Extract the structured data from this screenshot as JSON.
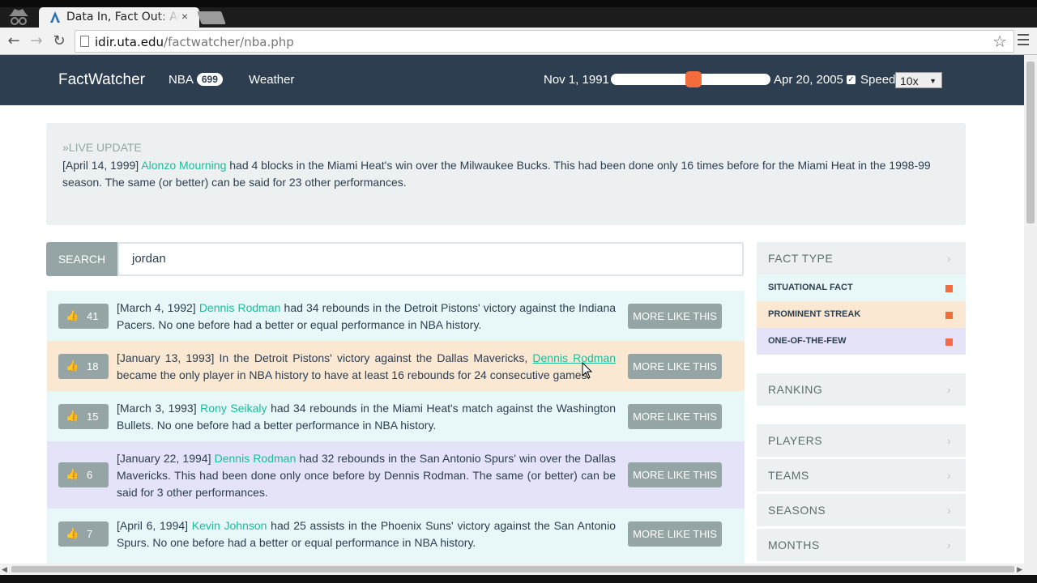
{
  "browser": {
    "tab_title": "Data In, Fact Out: Au",
    "tab_close": "×",
    "url_host": "idir.uta.edu",
    "url_path": "/factwatcher/nba.php"
  },
  "navbar": {
    "brand": "FactWatcher",
    "nba_label": "NBA",
    "nba_count": "699",
    "weather_label": "Weather",
    "date_start": "Nov 1, 1991",
    "date_end": "Apr 20, 2005",
    "date_current": "Apr 17, 1999",
    "slider_position": 0.52,
    "speed_label": "Speed",
    "speed_value": "10x",
    "speed_checked": true
  },
  "live_update": {
    "heading": "»LIVE UPDATE",
    "date": "[April 14, 1999]",
    "player": "Alonzo Mourning",
    "text": "had 4 blocks in the Miami Heat's win over the Milwaukee Bucks. This had been done only 16 times before for the Miami Heat in the 1998-99 season. The same (or better) can be said for 23 other performances."
  },
  "search": {
    "button_label": "SEARCH",
    "value": "jordan"
  },
  "facts": [
    {
      "likes": "41",
      "type": "situational",
      "pre": "[March 4, 1992]",
      "player": "Dennis Rodman",
      "post": "had 34 rebounds in the Detroit Pistons' victory against the Indiana Pacers. No one before had a better or equal performance in NBA history.",
      "more_label": "MORE LIKE THIS"
    },
    {
      "likes": "18",
      "type": "prominent",
      "pre": "[January 13, 1993] In the Detroit Pistons' victory against the Dallas Mavericks,",
      "player": "Dennis Rodman",
      "post": "became the only player in NBA history to have at least 16 rebounds for 24 consecutive games.",
      "more_label": "MORE LIKE THIS"
    },
    {
      "likes": "15",
      "type": "situational",
      "pre": "[March 3, 1993]",
      "player": "Rony Seikaly",
      "post": "had 34 rebounds in the Miami Heat's match against the Washington Bullets. No one before had a better performance in NBA history.",
      "more_label": "MORE LIKE THIS"
    },
    {
      "likes": "6",
      "type": "onefew",
      "pre": "[January 22, 1994]",
      "player": "Dennis Rodman",
      "post": "had 32 rebounds in the San Antonio Spurs' win over the Dallas Mavericks. This had been done only once before by Dennis Rodman. The same (or better) can be said for 3 other performances.",
      "more_label": "MORE LIKE THIS"
    },
    {
      "likes": "7",
      "type": "situational",
      "pre": "[April 6, 1994]",
      "player": "Kevin Johnson",
      "post": "had 25 assists in the Phoenix Suns' victory against the San Antonio Spurs. No one before had a better or equal performance in NBA history.",
      "more_label": "MORE LIKE THIS"
    }
  ],
  "sidebar": {
    "fact_type_label": "FACT TYPE",
    "types": [
      {
        "label": "SITUATIONAL FACT"
      },
      {
        "label": "PROMINENT STREAK"
      },
      {
        "label": "ONE-OF-THE-FEW"
      }
    ],
    "ranking_label": "RANKING",
    "players_label": "PLAYERS",
    "teams_label": "TEAMS",
    "seasons_label": "SEASONS",
    "months_label": "MONTHS",
    "chevron": "›"
  },
  "colors": {
    "navbar": "#2c3e50",
    "accent": "#f36c3b",
    "link": "#1abc9c",
    "situational_bg": "#e8f8f8",
    "prominent_bg": "#fbe8d2",
    "onefew_bg": "#e4e3f7"
  }
}
